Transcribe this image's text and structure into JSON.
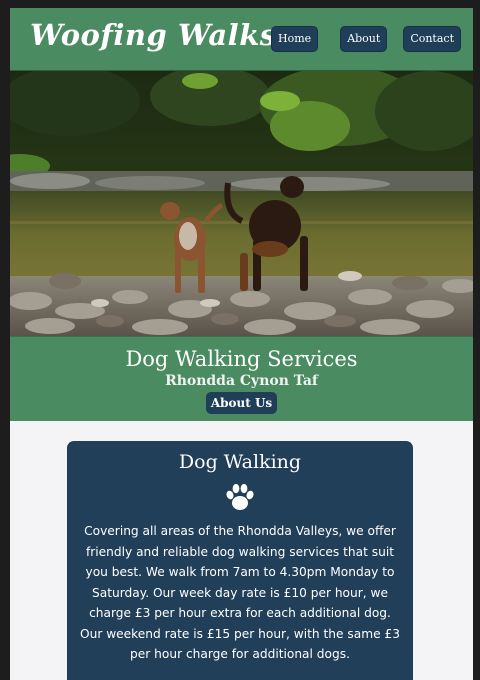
{
  "header": {
    "logo": "Woofing Walks",
    "nav": [
      "Home",
      "About",
      "Contact"
    ]
  },
  "hero": {
    "image": "two dogs standing on river stones by water"
  },
  "banner": {
    "title": "Dog Walking Services",
    "subtitle": "Rhondda Cynon Taf",
    "button": "About Us"
  },
  "card": {
    "title": "Dog Walking",
    "icon": "paw-icon",
    "text": "Covering all areas of the Rhondda Valleys, we offer friendly and reliable dog walking services that suit you best. We walk from 7am to 4.30pm Monday to Saturday. Our week day rate is £10 per hour, we charge £3 per hour extra for each additional dog. Our weekend rate is £15 per hour, with the same £3 per hour charge for additional dogs."
  },
  "colors": {
    "green": "#4b8b61",
    "navy": "#213f58",
    "page": "#f4f4f6"
  }
}
